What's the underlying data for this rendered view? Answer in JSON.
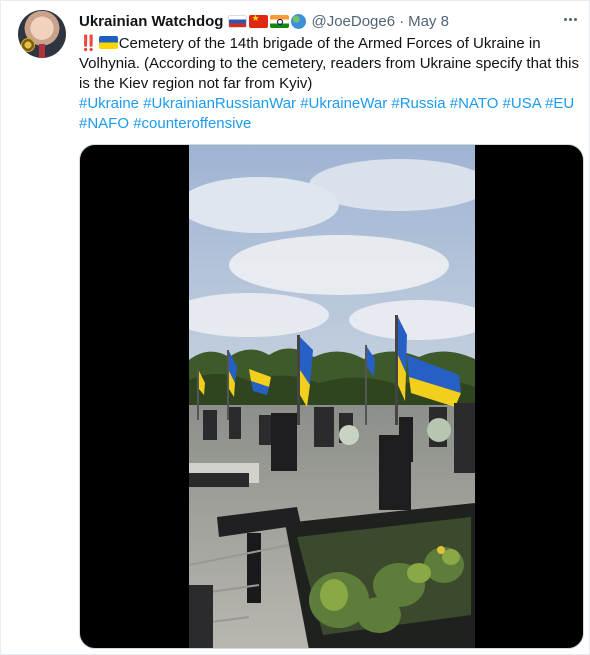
{
  "tweet": {
    "author_name": "Ukrainian Watchdog",
    "handle": "@JoeDoge6",
    "separator": "·",
    "date": "May 8",
    "icons": [
      "flag-russia-icon",
      "flag-china-icon",
      "flag-india-icon",
      "globe-icon"
    ],
    "body_prefix": "‼️",
    "body_text": "Cemetery of the 14th brigade of the Armed Forces of Ukraine in Volhynia. (According to the cemetery, readers from Ukraine specify that this is the Kiev region not far from Kyiv)",
    "hashtags": [
      "#Ukraine",
      "#UkrainianRussianWar",
      "#UkraineWar",
      "#Russia",
      "#NATO",
      "#USA",
      "#EU",
      "#NAFO",
      "#counteroffensive"
    ]
  },
  "colors": {
    "link": "#1d9bf0",
    "muted_text": "#536471",
    "text": "#0f1419"
  }
}
